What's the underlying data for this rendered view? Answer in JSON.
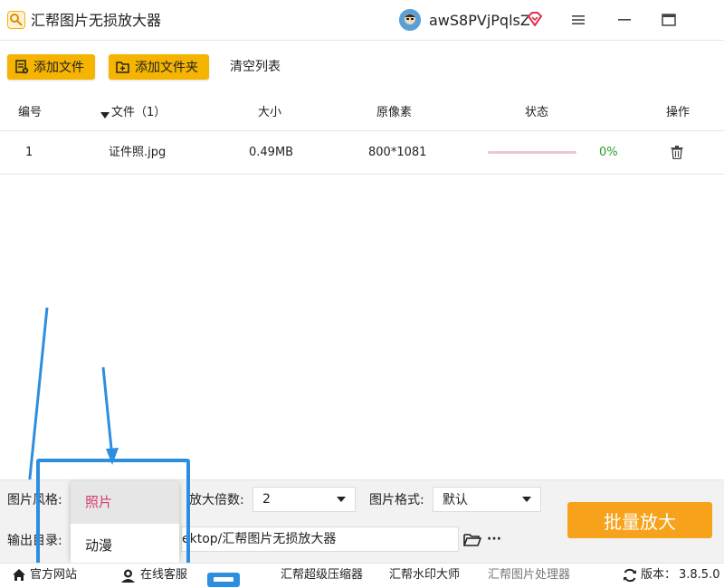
{
  "app": {
    "title": "汇帮图片无损放大器",
    "username": "awS8PVjPqlsZ"
  },
  "toolbar": {
    "add_file": "添加文件",
    "add_folder": "添加文件夹",
    "clear_list": "清空列表"
  },
  "table": {
    "headers": {
      "index": "编号",
      "file": "文件（1）",
      "size": "大小",
      "pixels": "原像素",
      "status": "状态",
      "action": "操作"
    },
    "rows": [
      {
        "index": "1",
        "file": "证件照.jpg",
        "size": "0.49MB",
        "pixels": "800*1081",
        "progress": 0,
        "status_text": "0%"
      }
    ]
  },
  "settings": {
    "style_label": "图片风格:",
    "style_options": [
      "照片",
      "动漫"
    ],
    "scale_label": "放大倍数:",
    "scale_value": "2",
    "format_label": "图片格式:",
    "format_value": "默认",
    "output_label": "输出目录:",
    "output_value": "ektop/汇帮图片无损放大器",
    "more": "···",
    "batch_button": "批量放大"
  },
  "footer": {
    "official_site": "官方网站",
    "online_service": "在线客服",
    "compressor": "汇帮超级压缩器",
    "watermark": "汇帮水印大师",
    "processor": "汇帮图片处理器",
    "version_label": "版本：",
    "version": "3.8.5.0"
  },
  "colors": {
    "accent": "#f5b400",
    "highlight": "#2d8ee0",
    "batch": "#f7a21b",
    "success": "#2a9d2a"
  },
  "icons": [
    "app-icon",
    "vip-diamond-icon",
    "menu-icon",
    "minimize-icon",
    "maximize-icon",
    "add-file-icon",
    "add-folder-icon",
    "sort-caret-icon",
    "trash-icon",
    "folder-open-icon",
    "home-icon",
    "support-icon",
    "refresh-icon"
  ]
}
